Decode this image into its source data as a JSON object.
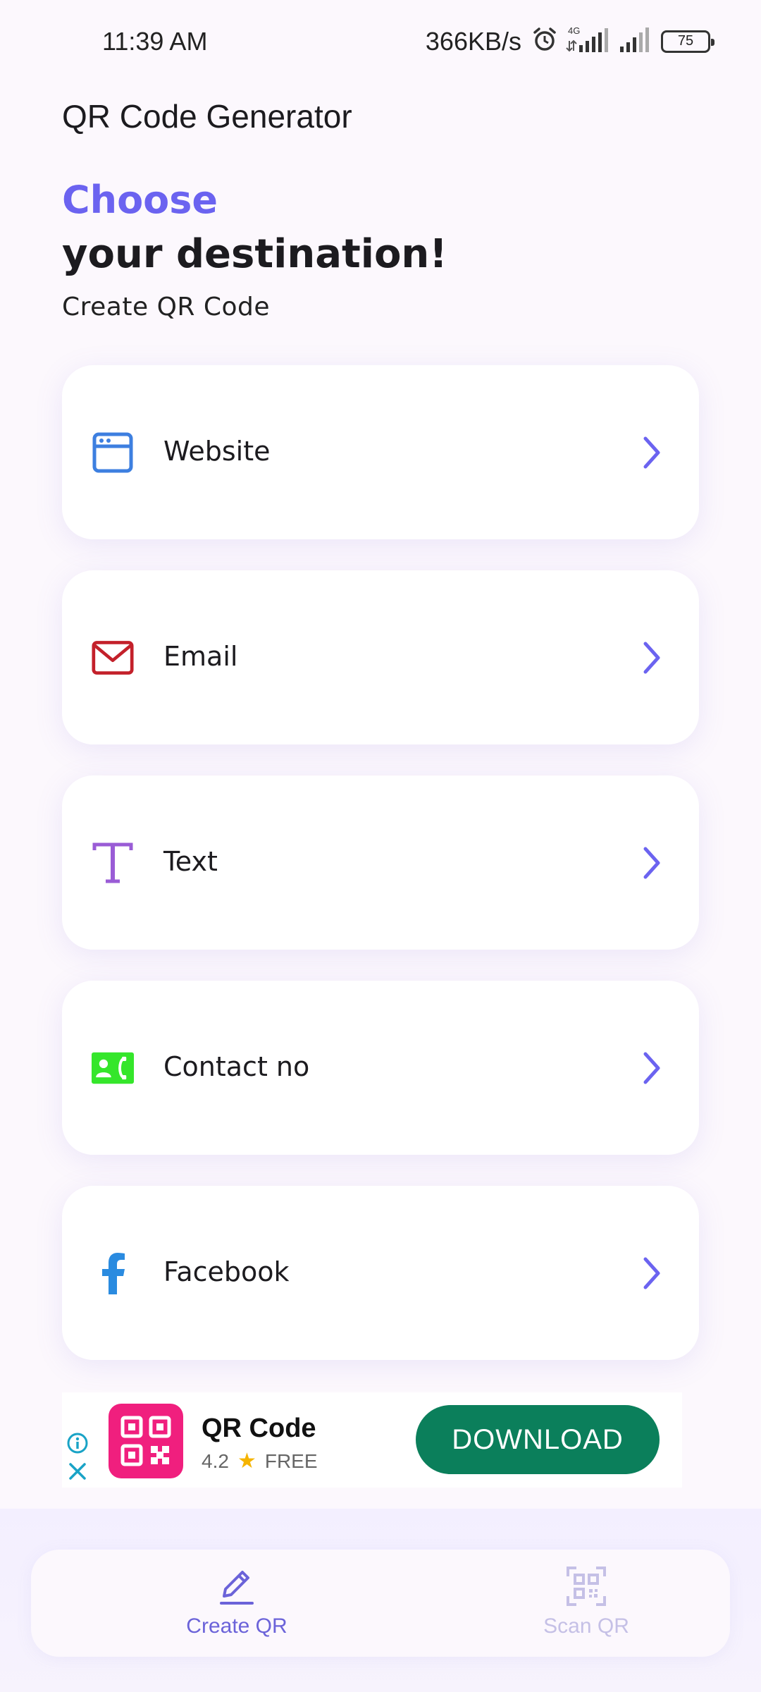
{
  "status_bar": {
    "time": "11:39 AM",
    "speed": "366KB/s",
    "network": "4G",
    "battery": "75"
  },
  "app": {
    "title": "QR Code Generator"
  },
  "header": {
    "accent": "Choose",
    "title": "your destination!",
    "subtitle": "Create QR Code"
  },
  "options": [
    {
      "label": "Website",
      "icon": "browser-window-icon",
      "color": "#3d7fe0"
    },
    {
      "label": "Email",
      "icon": "envelope-icon",
      "color": "#c3202a"
    },
    {
      "label": "Text",
      "icon": "text-t-icon",
      "color": "#9a5cd6"
    },
    {
      "label": "Contact no",
      "icon": "contact-phone-icon",
      "color": "#35e62b"
    },
    {
      "label": "Facebook",
      "icon": "facebook-icon",
      "color": "#2a8be0"
    }
  ],
  "chevron_color": "#6b63f0",
  "ad": {
    "name": "QR Code",
    "rating": "4.2",
    "price": "FREE",
    "cta": "DOWNLOAD",
    "logo_color": "#f01f7e",
    "cta_color": "#0b7f5b"
  },
  "nav": {
    "create_label": "Create QR",
    "scan_label": "Scan QR",
    "active": "Create QR"
  }
}
